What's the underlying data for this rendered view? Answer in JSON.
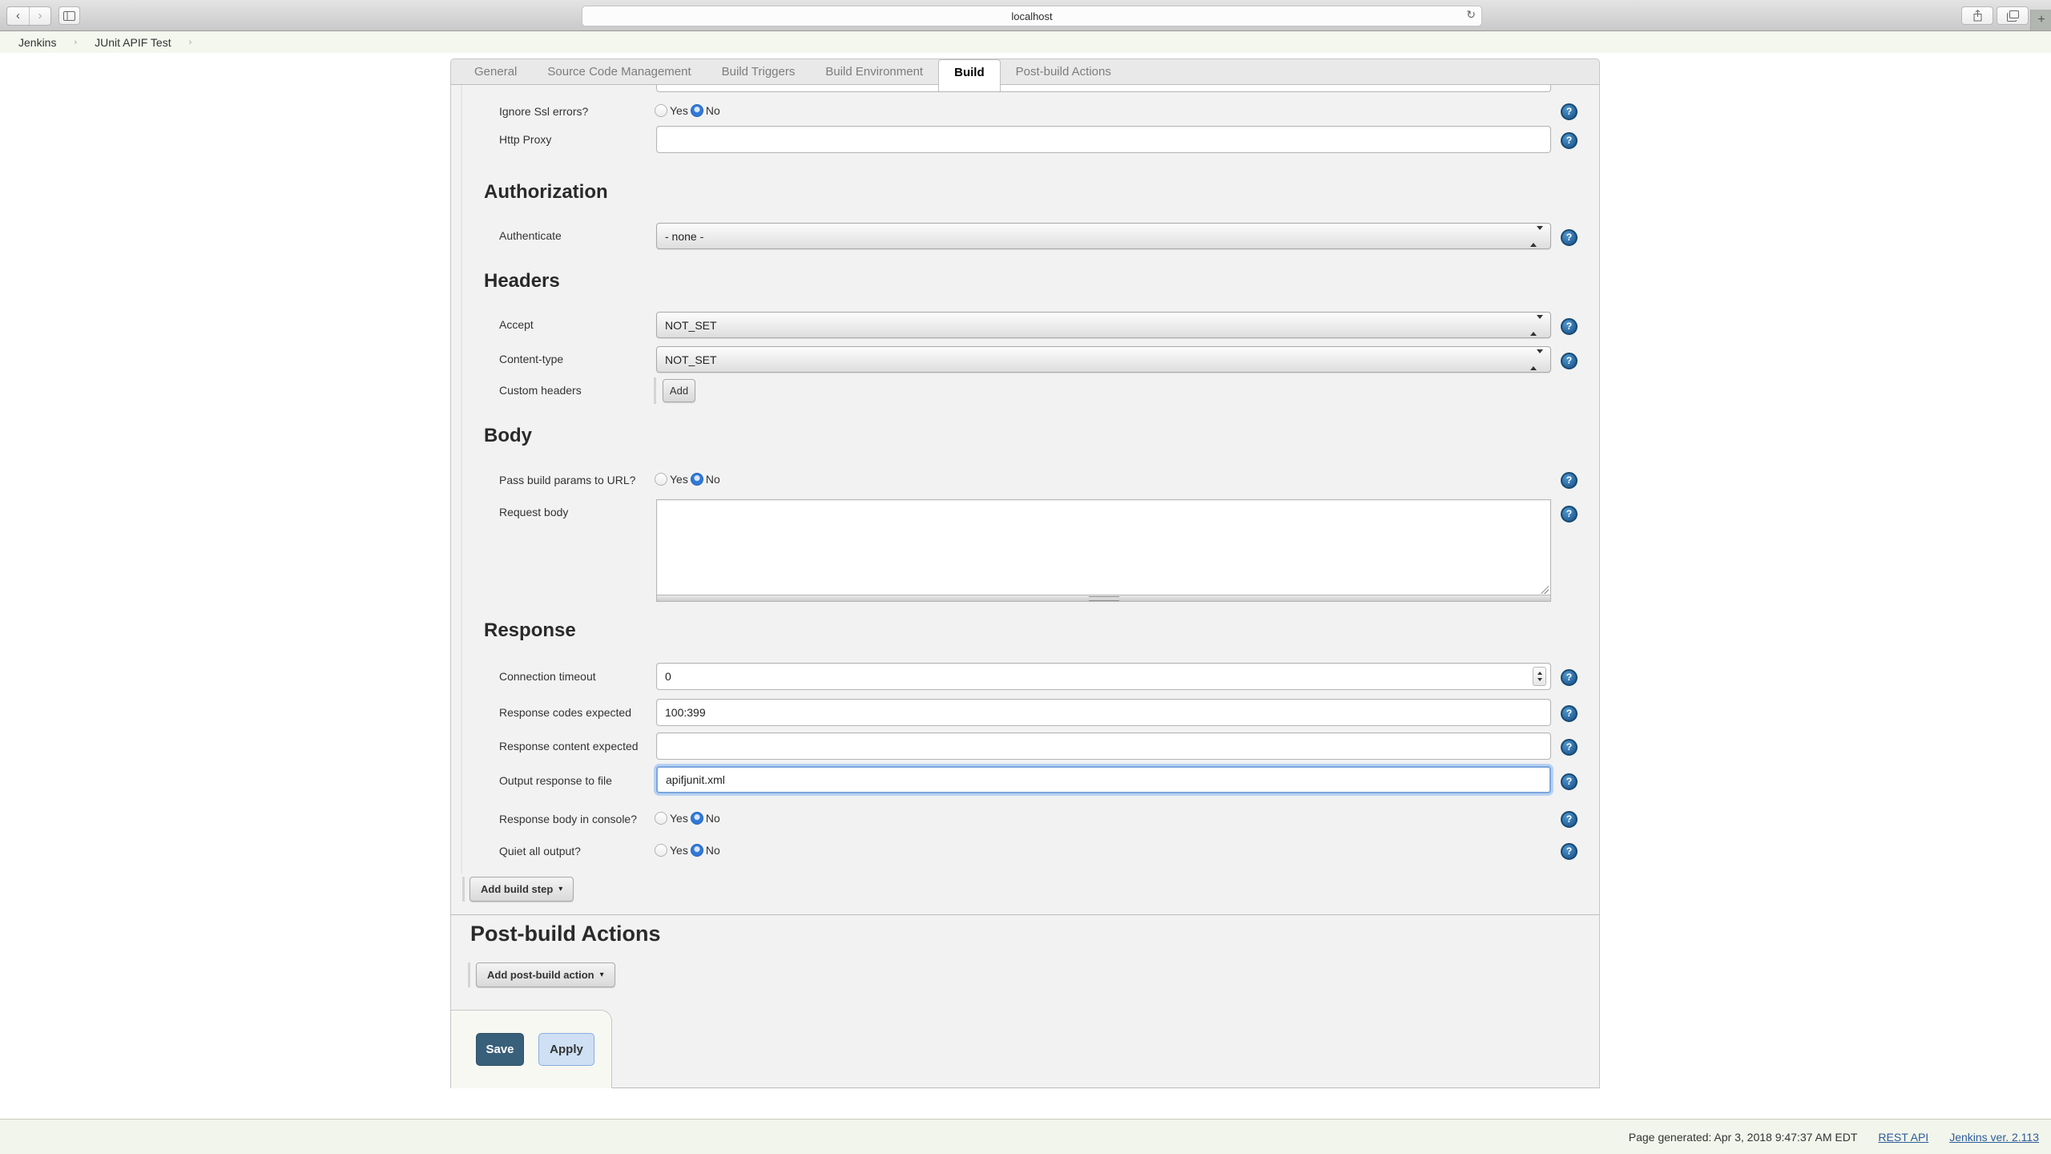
{
  "glyphs": {
    "help": "?",
    "caret_down": "▾",
    "back": "‹",
    "forward": "›",
    "reload": "↻",
    "plus": "+"
  },
  "browser": {
    "url_text": "localhost"
  },
  "breadcrumb": {
    "separator": "›",
    "items": [
      {
        "label": "Jenkins"
      },
      {
        "label": "JUnit APIF Test"
      }
    ]
  },
  "tabs": {
    "active": "Build",
    "items": [
      {
        "label": "General"
      },
      {
        "label": "Source Code Management"
      },
      {
        "label": "Build Triggers"
      },
      {
        "label": "Build Environment"
      },
      {
        "label": "Build"
      },
      {
        "label": "Post-build Actions"
      }
    ]
  },
  "http_request_step": {
    "ignore_ssl": {
      "label": "Ignore Ssl errors?",
      "yes_label": "Yes",
      "no_label": "No",
      "selected": "No"
    },
    "http_proxy": {
      "label": "Http Proxy",
      "value": ""
    },
    "authorization": {
      "heading": "Authorization",
      "authenticate": {
        "label": "Authenticate",
        "value": "- none -"
      }
    },
    "headers": {
      "heading": "Headers",
      "accept": {
        "label": "Accept",
        "value": "NOT_SET"
      },
      "content_type": {
        "label": "Content-type",
        "value": "NOT_SET"
      },
      "custom_headers": {
        "label": "Custom headers",
        "add_label": "Add"
      }
    },
    "body": {
      "heading": "Body",
      "pass_params": {
        "label": "Pass build params to URL?",
        "yes_label": "Yes",
        "no_label": "No",
        "selected": "No"
      },
      "request_body": {
        "label": "Request body",
        "value": ""
      }
    },
    "response": {
      "heading": "Response",
      "connection_timeout": {
        "label": "Connection timeout",
        "value": "0"
      },
      "codes_expected": {
        "label": "Response codes expected",
        "value": "100:399"
      },
      "content_expected": {
        "label": "Response content expected",
        "value": ""
      },
      "output_file": {
        "label": "Output response to file",
        "value": "apifjunit.xml",
        "focused": true
      },
      "body_in_console": {
        "label": "Response body in console?",
        "yes_label": "Yes",
        "no_label": "No",
        "selected": "No"
      },
      "quiet": {
        "label": "Quiet all output?",
        "yes_label": "Yes",
        "no_label": "No",
        "selected": "No"
      }
    }
  },
  "build_section": {
    "add_step_label": "Add build step"
  },
  "post_build": {
    "heading": "Post-build Actions",
    "add_action_label": "Add post-build action"
  },
  "actions": {
    "save_label": "Save",
    "apply_label": "Apply"
  },
  "footer": {
    "generated": "Page generated: Apr 3, 2018 9:47:37 AM EDT",
    "rest_api_label": "REST API",
    "version_label": "Jenkins ver. 2.113"
  },
  "colors": {
    "save_bg": "#39607a",
    "apply_bg": "#cfe0f4",
    "link": "#2c5d9b",
    "radio_selected": "#3079d8",
    "help_icon": "#256099",
    "panel_bg": "#f2f2f2"
  }
}
